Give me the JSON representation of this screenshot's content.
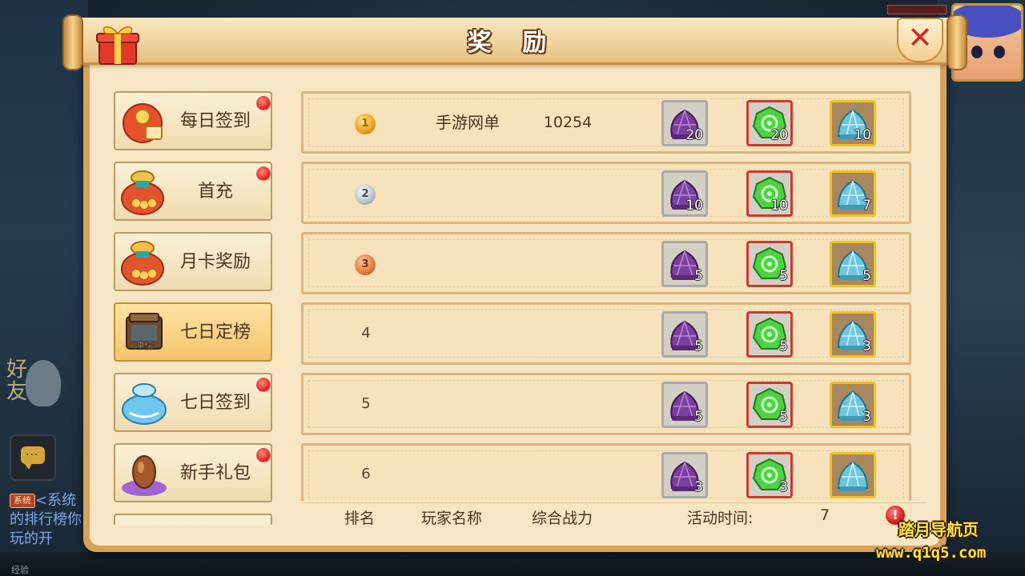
{
  "window": {
    "title": "奖 励"
  },
  "background": {
    "friend_label": "好友",
    "system_tag": "系统",
    "system_message": "<系统的排行榜你玩的开",
    "xp_label": "经验"
  },
  "sidebar": {
    "items": [
      {
        "label": "每日签到",
        "icon": "red-envelope-icon",
        "has_badge": true,
        "active": false
      },
      {
        "label": "首充",
        "icon": "treasure-bag-icon",
        "has_badge": true,
        "active": false
      },
      {
        "label": "月卡奖励",
        "icon": "treasure-bag-icon",
        "has_badge": false,
        "active": false
      },
      {
        "label": "七日定榜",
        "icon": "ranking-chest-icon",
        "icon_text": "冲榜",
        "has_badge": false,
        "active": true
      },
      {
        "label": "七日签到",
        "icon": "blue-bag-icon",
        "has_badge": true,
        "active": false
      },
      {
        "label": "新手礼包",
        "icon": "magic-egg-icon",
        "has_badge": true,
        "active": false
      }
    ]
  },
  "ranking": {
    "rows": [
      {
        "rank": "1",
        "medal": "gold",
        "player": "手游网单",
        "power": "10254",
        "rewards": [
          "20",
          "20",
          "10"
        ]
      },
      {
        "rank": "2",
        "medal": "silver",
        "player": "",
        "power": "",
        "rewards": [
          "10",
          "10",
          "7"
        ]
      },
      {
        "rank": "3",
        "medal": "bronze",
        "player": "",
        "power": "",
        "rewards": [
          "5",
          "5",
          "5"
        ]
      },
      {
        "rank": "4",
        "medal": "",
        "player": "",
        "power": "",
        "rewards": [
          "5",
          "5",
          "3"
        ]
      },
      {
        "rank": "5",
        "medal": "",
        "player": "",
        "power": "",
        "rewards": [
          "5",
          "5",
          "3"
        ]
      },
      {
        "rank": "6",
        "medal": "",
        "player": "",
        "power": "",
        "rewards": [
          "3",
          "3",
          ""
        ]
      }
    ],
    "reward_items": [
      "purple-pouch-icon",
      "green-jade-icon",
      "blue-pouch-icon"
    ]
  },
  "footer": {
    "col_rank": "排名",
    "col_player": "玩家名称",
    "col_power": "综合战力",
    "activity_time_label": "活动时间:",
    "activity_time_value": "7"
  },
  "watermark": {
    "line1": "踏月导航页",
    "line2": "www.q1q5.com"
  },
  "colors": {
    "panel_bg": "#f6e6c3",
    "frame": "#d7a25a",
    "badge_red": "#e0302a",
    "text_brown": "#4d3420"
  }
}
